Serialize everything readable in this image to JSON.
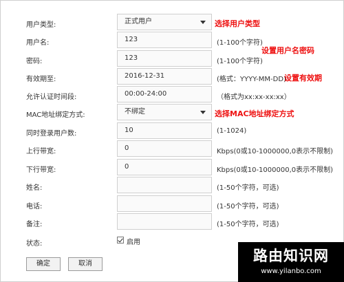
{
  "form": {
    "user_type": {
      "label": "用户类型:",
      "value": "正式用户"
    },
    "username": {
      "label": "用户名:",
      "value": "123",
      "hint": "(1-100个字符)"
    },
    "password": {
      "label": "密码:",
      "value": "123",
      "hint": "(1-100个字符)"
    },
    "expiry": {
      "label": "有效期至:",
      "value": "2016-12-31",
      "hint": "(格式：YYYY-MM-DD)"
    },
    "auth_time": {
      "label": "允许认证时间段:",
      "value": "00:00-24:00",
      "hint": "（格式为xx:xx-xx:xx）"
    },
    "mac_binding": {
      "label": "MAC地址绑定方式:",
      "value": "不绑定"
    },
    "concurrent_users": {
      "label": "同时登录用户数:",
      "value": "10",
      "hint": "(1-1024)"
    },
    "upload_bw": {
      "label": "上行带宽:",
      "value": "0",
      "hint": "Kbps(0或10-1000000,0表示不限制)"
    },
    "download_bw": {
      "label": "下行带宽:",
      "value": "0",
      "hint": "Kbps(0或10-1000000,0表示不限制)"
    },
    "name": {
      "label": "姓名:",
      "value": "",
      "hint": "(1-50个字符，可选)"
    },
    "phone": {
      "label": "电话:",
      "value": "",
      "hint": "(1-50个字符，可选)"
    },
    "remark": {
      "label": "备注:",
      "value": "",
      "hint": "(1-50个字符，可选)"
    },
    "status": {
      "label": "状态:",
      "checkbox_label": "启用",
      "checked": true
    }
  },
  "annotations": {
    "select_user_type": "选择用户类型",
    "set_user_password": "设置用户名密码",
    "set_expiry": "设置有效期",
    "select_mac_binding": "选择MAC地址绑定方式"
  },
  "buttons": {
    "ok": "确定",
    "cancel": "取消"
  },
  "watermark": {
    "title": "路由知识网",
    "url": "www.yilanbo.com"
  },
  "colors": {
    "annotation_red": "#ee1111",
    "field_border": "#cfcfcf",
    "watermark_bg": "#000000"
  }
}
